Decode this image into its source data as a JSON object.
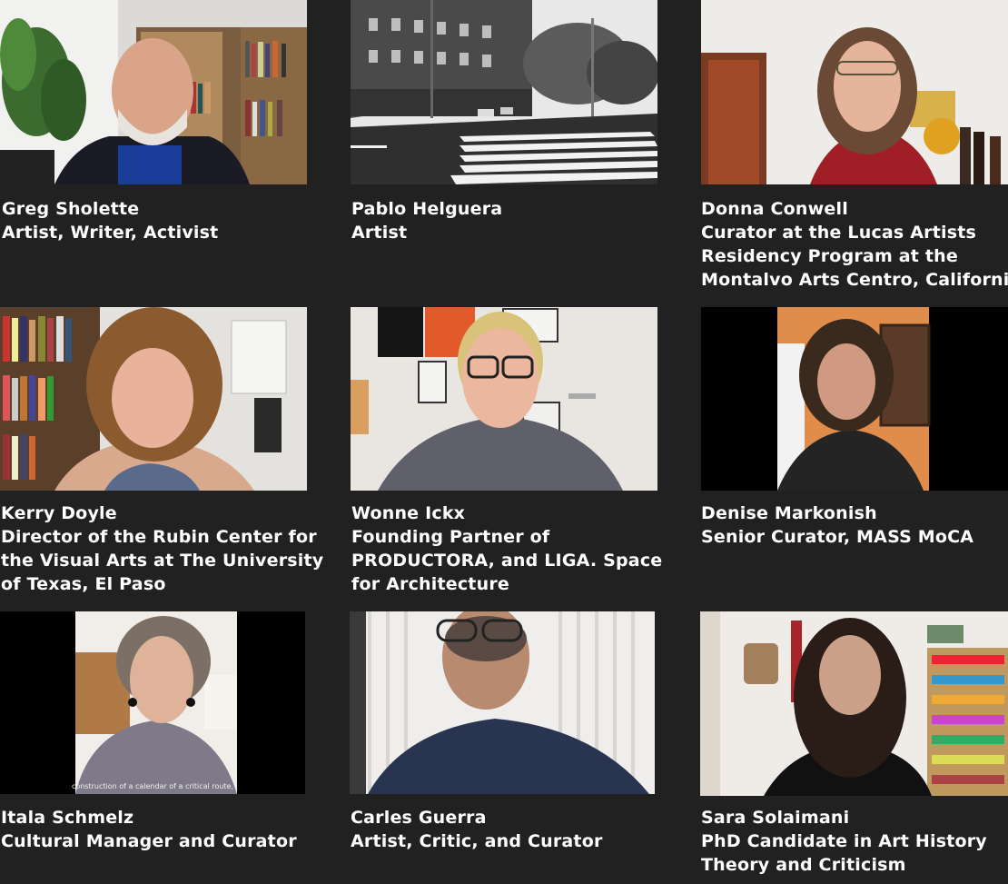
{
  "participants": [
    {
      "name": "Greg Sholette",
      "title_lines": [
        "Artist, Writer, Activist"
      ],
      "video": "man-bookshelf-plant"
    },
    {
      "name": "Pablo Helguera",
      "title_lines": [
        "Artist"
      ],
      "video": "street-intersection-bw"
    },
    {
      "name": "Donna Conwell",
      "title_lines": [
        "Curator at the Lucas Artists",
        "Residency Program at the",
        "Montalvo Arts Centro, California"
      ],
      "video": "woman-glasses-wall"
    },
    {
      "name": "Kerry Doyle",
      "title_lines": [
        "Director of the Rubin Center for",
        "the Visual Arts at The University",
        "of Texas, El Paso"
      ],
      "video": "woman-bookshelf"
    },
    {
      "name": "Wonne Ickx",
      "title_lines": [
        "Founding Partner of",
        "PRODUCTORA, and LIGA. Space",
        "for Architecture"
      ],
      "video": "man-glasses-posters"
    },
    {
      "name": "Denise Markonish",
      "title_lines": [
        "Senior Curator, MASS MoCA"
      ],
      "video": "woman-curly-hair"
    },
    {
      "name": "Itala Schmelz",
      "title_lines": [
        "Cultural Manager and Curator"
      ],
      "video": "woman-earrings",
      "subtitle": "construction of a calendar of a critical route,"
    },
    {
      "name": "Carles Guerra",
      "title_lines": [
        "Artist, Critic, and Curator"
      ],
      "video": "man-glasses-blinds"
    },
    {
      "name": "Sara Solaimani",
      "title_lines": [
        "PhD Candidate in Art History",
        "Theory and Criticism"
      ],
      "video": "woman-dark-hair-shelves"
    }
  ],
  "colors": {
    "background": "#212121",
    "text": "#ffffff",
    "letterbox": "#000000"
  },
  "icons": []
}
